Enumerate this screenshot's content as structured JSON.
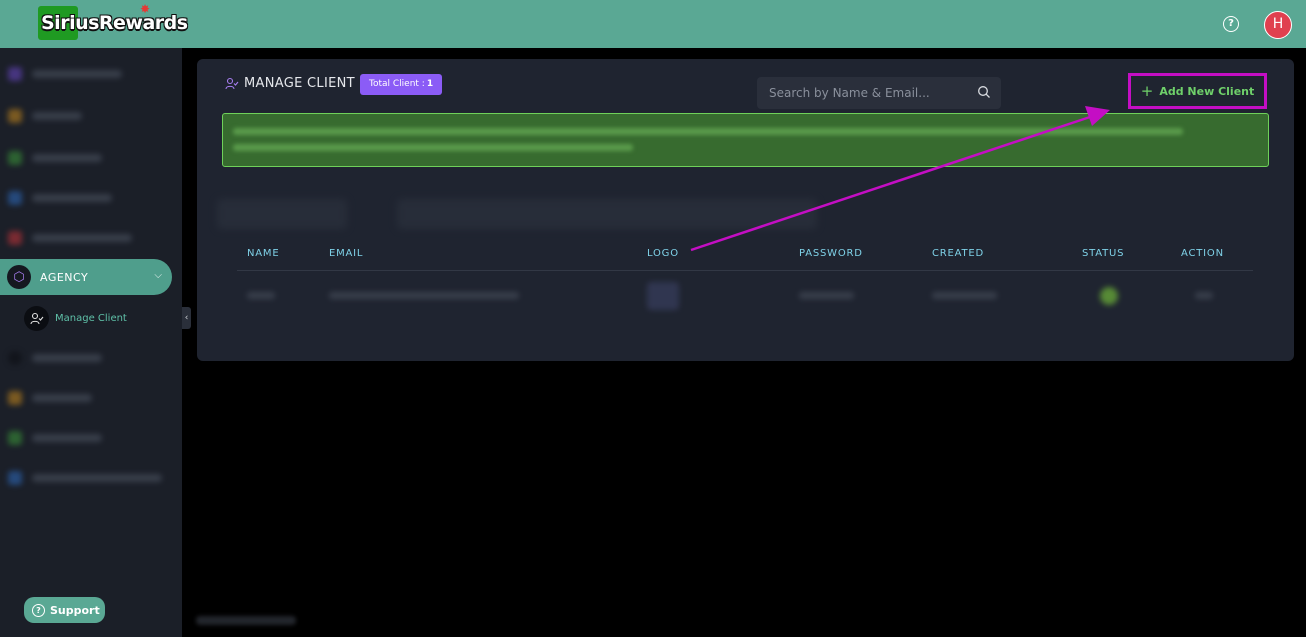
{
  "app": {
    "logo_text": "SiriusRewards"
  },
  "topbar": {
    "help_icon": "question-circle-icon",
    "avatar_letter": "H"
  },
  "sidebar": {
    "section_label": "AGENCY",
    "active_item": "Manage Client",
    "support_label": "Support"
  },
  "panel": {
    "title": "MANAGE CLIENT",
    "badge_label": "Total Client :",
    "badge_count": "1",
    "search_placeholder": "Search by Name & Email...",
    "add_button_label": "Add New Client"
  },
  "table": {
    "columns": [
      "NAME",
      "EMAIL",
      "LOGO",
      "PASSWORD",
      "CREATED",
      "STATUS",
      "ACTION"
    ]
  },
  "colors": {
    "topbar": "#5aa894",
    "accent_purple": "#8b5cf6",
    "highlight_magenta": "#c40ec4",
    "add_text_green": "#6fd06a"
  }
}
